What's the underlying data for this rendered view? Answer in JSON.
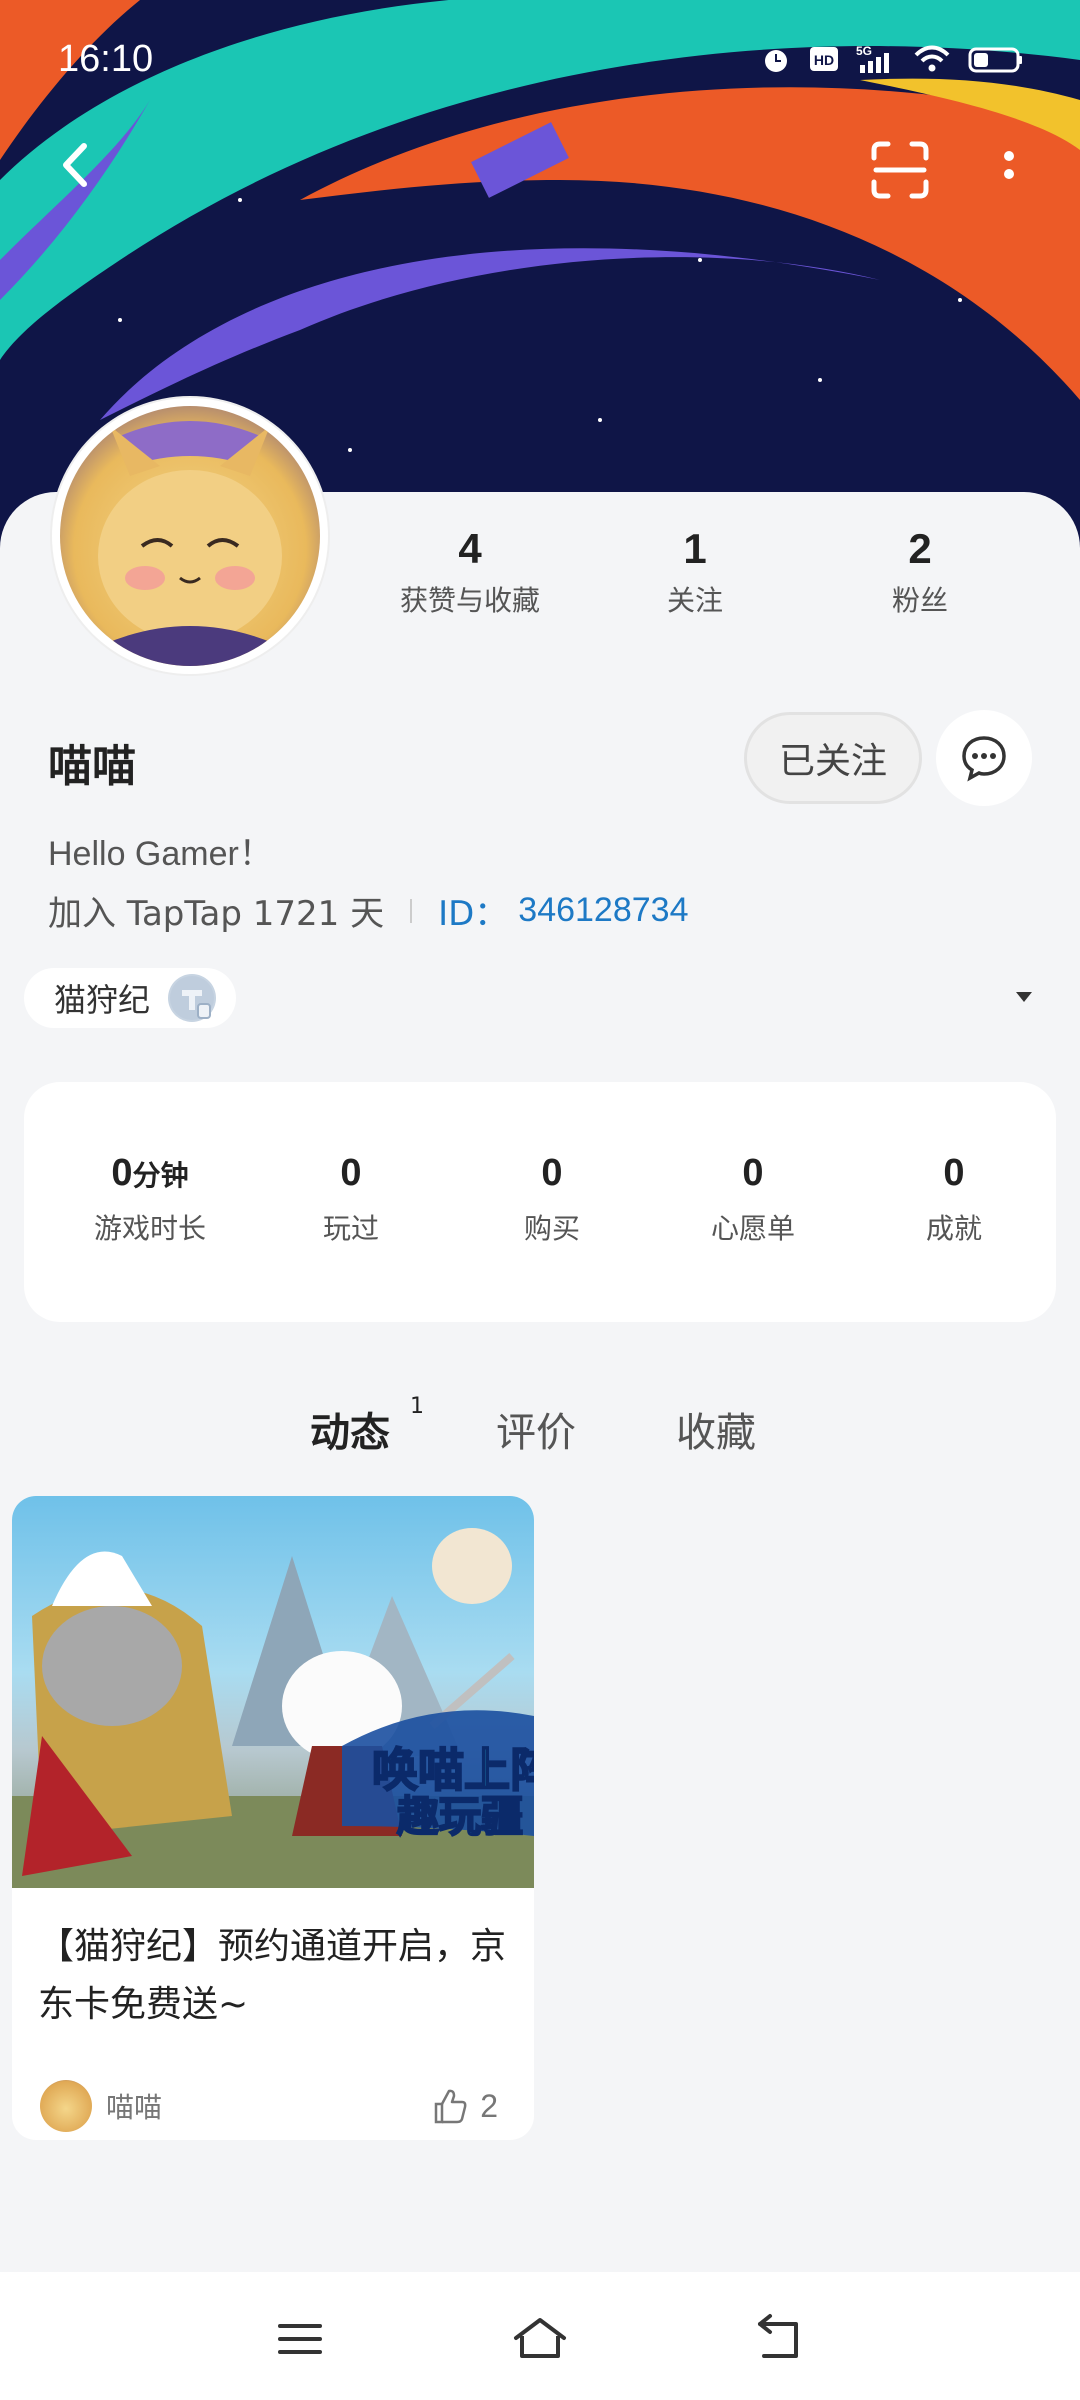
{
  "status_bar": {
    "time": "16:10",
    "icons": [
      "alarm-icon",
      "hd-icon",
      "5g-signal-icon",
      "wifi-icon",
      "battery-icon"
    ]
  },
  "header": {
    "icons": [
      "back-arrow-icon",
      "scan-icon",
      "more-vertical-icon"
    ]
  },
  "profile": {
    "name": "喵喵",
    "bio": "Hello Gamer！",
    "join_text": "加入 TapTap 1721 天",
    "id_label": "ID：",
    "id_value": "346128734",
    "follow_label": "已关注",
    "stats": [
      {
        "value": "4",
        "label": "获赞与收藏"
      },
      {
        "value": "1",
        "label": "关注"
      },
      {
        "value": "2",
        "label": "粉丝"
      }
    ]
  },
  "game_chip": {
    "label": "猫狩纪"
  },
  "game_stats": [
    {
      "value": "0",
      "unit": "分钟",
      "label": "游戏时长"
    },
    {
      "value": "0",
      "unit": "",
      "label": "玩过"
    },
    {
      "value": "0",
      "unit": "",
      "label": "购买"
    },
    {
      "value": "0",
      "unit": "",
      "label": "心愿单"
    },
    {
      "value": "0",
      "unit": "",
      "label": "成就"
    }
  ],
  "tabs": [
    {
      "label": "动态",
      "badge": "1",
      "active": true
    },
    {
      "label": "评价",
      "badge": "",
      "active": false
    },
    {
      "label": "收藏",
      "badge": "",
      "active": false
    }
  ],
  "posts": [
    {
      "title": "【猫狩纪】预约通道开启，京东卡免费送~",
      "author": "喵喵",
      "likes": "2",
      "image_banner_text": "唤喵上阵 趣玩疆"
    }
  ],
  "colors": {
    "accent": "#15c5ce",
    "link": "#1d79c5",
    "banner_bg": "#0f1547",
    "banner_teal": "#1bc6b4",
    "banner_orange": "#ec5a27",
    "banner_purple": "#6b55d8",
    "banner_yellow": "#f2c22c"
  },
  "nav_bar": {
    "icons": [
      "menu-icon",
      "home-icon",
      "back-icon"
    ]
  }
}
